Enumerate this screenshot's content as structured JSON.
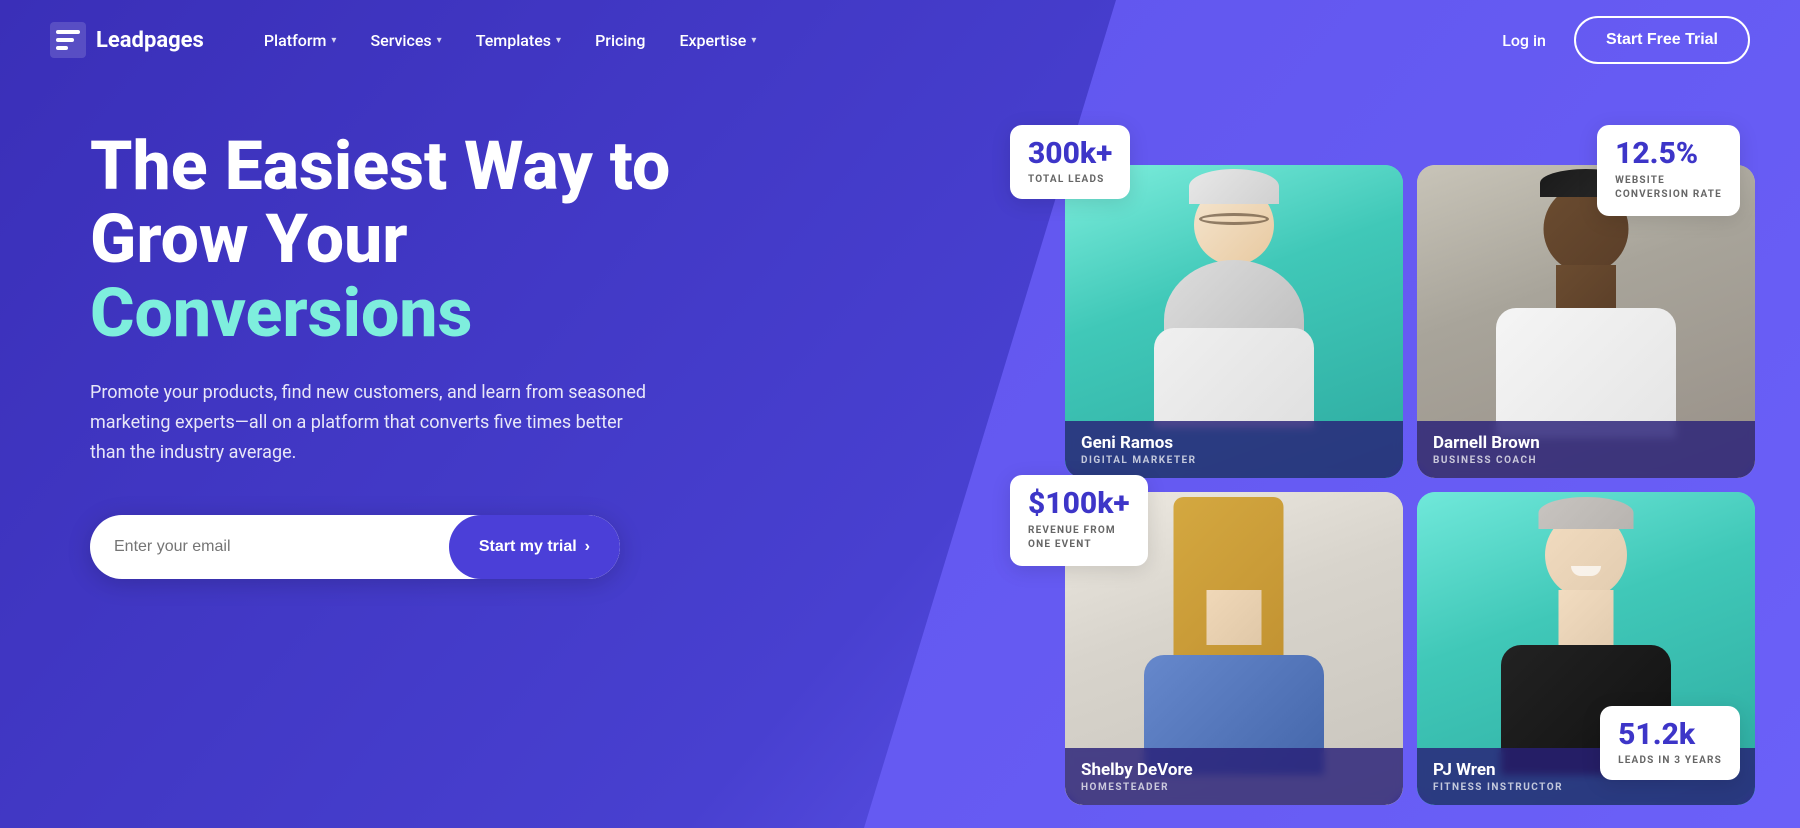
{
  "brand": {
    "name": "Leadpages",
    "logo_alt": "Leadpages logo"
  },
  "nav": {
    "items": [
      {
        "label": "Platform",
        "has_dropdown": true
      },
      {
        "label": "Services",
        "has_dropdown": true
      },
      {
        "label": "Templates",
        "has_dropdown": true
      },
      {
        "label": "Pricing",
        "has_dropdown": false
      },
      {
        "label": "Expertise",
        "has_dropdown": true
      }
    ],
    "login_label": "Log in",
    "trial_label": "Start Free Trial"
  },
  "hero": {
    "headline_line1": "The Easiest Way to",
    "headline_line2": "Grow Your ",
    "headline_accent": "Conversions",
    "subtext": "Promote your products, find new customers, and learn from seasoned marketing experts—all on a platform that converts five times better than the industry average.",
    "email_placeholder": "Enter your email",
    "cta_label": "Start my trial"
  },
  "profiles": [
    {
      "id": "geni",
      "name": "Geni Ramos",
      "title": "Digital Marketer",
      "bg_color": "#5EDDD0",
      "stat_value": "300k+",
      "stat_label": "Total Leads",
      "stat_position": "top-left"
    },
    {
      "id": "darnell",
      "name": "Darnell Brown",
      "title": "Business Coach",
      "bg_color": "#D8D4C8",
      "stat_value": "12.5%",
      "stat_label": "Website\nConversion Rate",
      "stat_position": "top-right"
    },
    {
      "id": "shelby",
      "name": "Shelby DeVore",
      "title": "Homesteader",
      "bg_color": "#F0EDE6",
      "stat_value": "$100k+",
      "stat_label": "Revenue From\nOne Event",
      "stat_position": "bottom-left"
    },
    {
      "id": "pj",
      "name": "PJ Wren",
      "title": "Fitness Instructor",
      "bg_color": "#5EDDD0",
      "stat_value": "51.2k",
      "stat_label": "Leads In 3 Years",
      "stat_position": "bottom-right"
    }
  ],
  "colors": {
    "primary_purple": "#4B3FD8",
    "dark_purple": "#3730B8",
    "light_teal": "#7EEEDD",
    "stat_blue": "#3D35C8"
  }
}
